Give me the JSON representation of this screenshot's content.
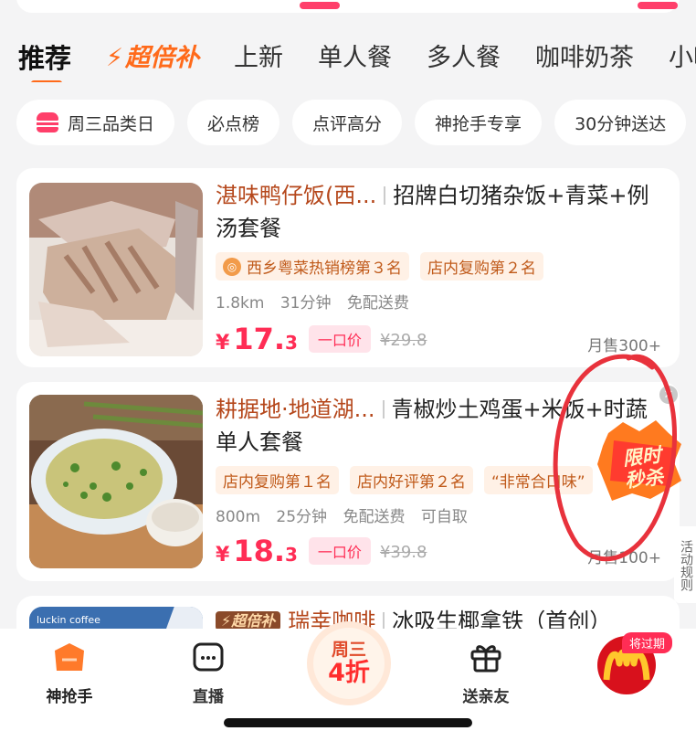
{
  "tabs": [
    {
      "label": "推荐",
      "active": true
    },
    {
      "label": "超倍补",
      "style": "super"
    },
    {
      "label": "上新"
    },
    {
      "label": "单人餐"
    },
    {
      "label": "多人餐"
    },
    {
      "label": "咖啡奶茶"
    },
    {
      "label": "小吃"
    }
  ],
  "chips": [
    "周三品类日",
    "必点榜",
    "点评高分",
    "神抢手专享",
    "30分钟送达"
  ],
  "items": [
    {
      "shop": "湛味鸭仔饭(西...",
      "title": "招牌白切猪杂饭+青菜+例汤套餐",
      "tags": [
        "西乡粤菜热销榜第３名",
        "店内复购第２名"
      ],
      "meta": [
        "1.8km",
        "31分钟",
        "免配送费"
      ],
      "price_int": "17.",
      "price_dec": "3",
      "deal": "一口价",
      "orig": "¥29.8",
      "sales": "月售300+"
    },
    {
      "shop": "耕据地·地道湖...",
      "title": "青椒炒土鸡蛋+米饭+时蔬单人套餐",
      "tags": [
        "店内复购第１名",
        "店内好评第２名",
        "“非常合口味”"
      ],
      "meta": [
        "800m",
        "25分钟",
        "免配送费",
        "可自取"
      ],
      "price_int": "18.",
      "price_dec": "3",
      "deal": "一口价",
      "orig": "¥39.8",
      "sales": "月售100+"
    },
    {
      "badge": "超倍补",
      "shop": "瑞幸咖啡",
      "title": "冰吸生椰拿铁（首创）",
      "thumb_brand": "luckin coffee"
    }
  ],
  "currency": "¥",
  "seckill": {
    "line1": "限时",
    "line2": "秒杀"
  },
  "side_rules": "活动规则",
  "bottom_nav": {
    "items": [
      "神抢手",
      "直播",
      "送亲友"
    ],
    "center_l1": "周三",
    "center_l2": "4折",
    "mcd_badge": "将过期"
  },
  "colors": {
    "accent": "#ff6a1a",
    "price": "#ff2d55",
    "tag_bg": "#fff1e6"
  }
}
